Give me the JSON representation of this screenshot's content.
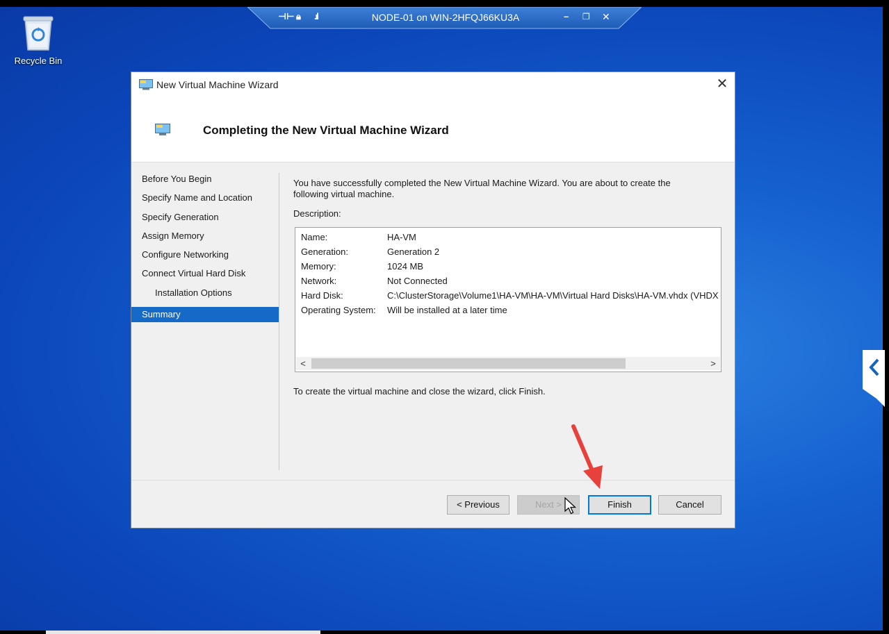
{
  "rdp_bar": {
    "title": "NODE-01 on WIN-2HFQJ66KU3A",
    "pin_icon": "pin-icon",
    "lock_icon": "lock-icon",
    "signal_icon": "signal-icon",
    "minimize_icon": "minimize-icon",
    "restore_icon": "restore-icon",
    "close_icon": "close-icon"
  },
  "desktop": {
    "recycle_bin_label": "Recycle Bin"
  },
  "wizard": {
    "window_title": "New Virtual Machine Wizard",
    "header_title": "Completing the New Virtual Machine Wizard",
    "nav_items": [
      {
        "label": "Before You Begin"
      },
      {
        "label": "Specify Name and Location"
      },
      {
        "label": "Specify Generation"
      },
      {
        "label": "Assign Memory"
      },
      {
        "label": "Configure Networking"
      },
      {
        "label": "Connect Virtual Hard Disk"
      },
      {
        "label": "Installation Options"
      },
      {
        "label": "Summary"
      }
    ],
    "intro_text": "You have successfully completed the New Virtual Machine Wizard. You are about to create the following virtual machine.",
    "description_label": "Description:",
    "description": [
      {
        "key": "Name:",
        "value": "HA-VM"
      },
      {
        "key": "Generation:",
        "value": "Generation 2"
      },
      {
        "key": "Memory:",
        "value": "1024 MB"
      },
      {
        "key": "Network:",
        "value": "Not Connected"
      },
      {
        "key": "Hard Disk:",
        "value": "C:\\ClusterStorage\\Volume1\\HA-VM\\HA-VM\\Virtual Hard Disks\\HA-VM.vhdx (VHDX"
      },
      {
        "key": "Operating System:",
        "value": "Will be installed at a later time"
      }
    ],
    "scroll_left": "<",
    "scroll_right": ">",
    "finish_note": "To create the virtual machine and close the wizard, click Finish.",
    "buttons": {
      "previous": "< Previous",
      "next": "Next >",
      "finish": "Finish",
      "cancel": "Cancel"
    }
  },
  "colors": {
    "selection": "#1569c7",
    "annotation_arrow": "#e8403a",
    "desktop_blue": "#1560cf"
  }
}
